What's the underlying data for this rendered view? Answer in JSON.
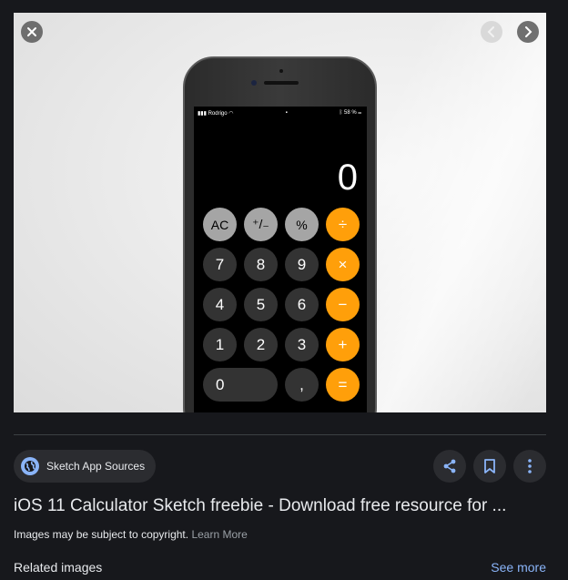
{
  "viewer": {
    "icons": {
      "close": "close-icon",
      "prev": "chevron-left-icon",
      "next": "chevron-right-icon"
    }
  },
  "calculator": {
    "status_carrier": "Rodrigo",
    "status_battery": "58 %",
    "display_value": "0",
    "keys": [
      {
        "label": "AC",
        "style": "light"
      },
      {
        "label": "⁺/₋",
        "style": "light"
      },
      {
        "label": "%",
        "style": "light"
      },
      {
        "label": "÷",
        "style": "orange"
      },
      {
        "label": "7",
        "style": "dark"
      },
      {
        "label": "8",
        "style": "dark"
      },
      {
        "label": "9",
        "style": "dark"
      },
      {
        "label": "×",
        "style": "orange"
      },
      {
        "label": "4",
        "style": "dark"
      },
      {
        "label": "5",
        "style": "dark"
      },
      {
        "label": "6",
        "style": "dark"
      },
      {
        "label": "−",
        "style": "orange"
      },
      {
        "label": "1",
        "style": "dark"
      },
      {
        "label": "2",
        "style": "dark"
      },
      {
        "label": "3",
        "style": "dark"
      },
      {
        "label": "+",
        "style": "orange"
      },
      {
        "label": "0",
        "style": "dark-zero"
      },
      {
        "label": ",",
        "style": "dark"
      },
      {
        "label": "=",
        "style": "orange"
      }
    ]
  },
  "source": {
    "label": "Sketch App Sources",
    "icon": "globe-icon"
  },
  "actions": {
    "share": "share-icon",
    "save": "bookmark-icon",
    "more": "more-vert-icon"
  },
  "result": {
    "title": "iOS 11 Calculator Sketch freebie - Download free resource for ...",
    "copyright_text": "Images may be subject to copyright.",
    "learn_more": "Learn More"
  },
  "related": {
    "heading": "Related images",
    "see_more": "See more"
  },
  "colors": {
    "accent": "#8ab4f8",
    "orange_key": "#ff9f0a",
    "background": "#17181c"
  }
}
